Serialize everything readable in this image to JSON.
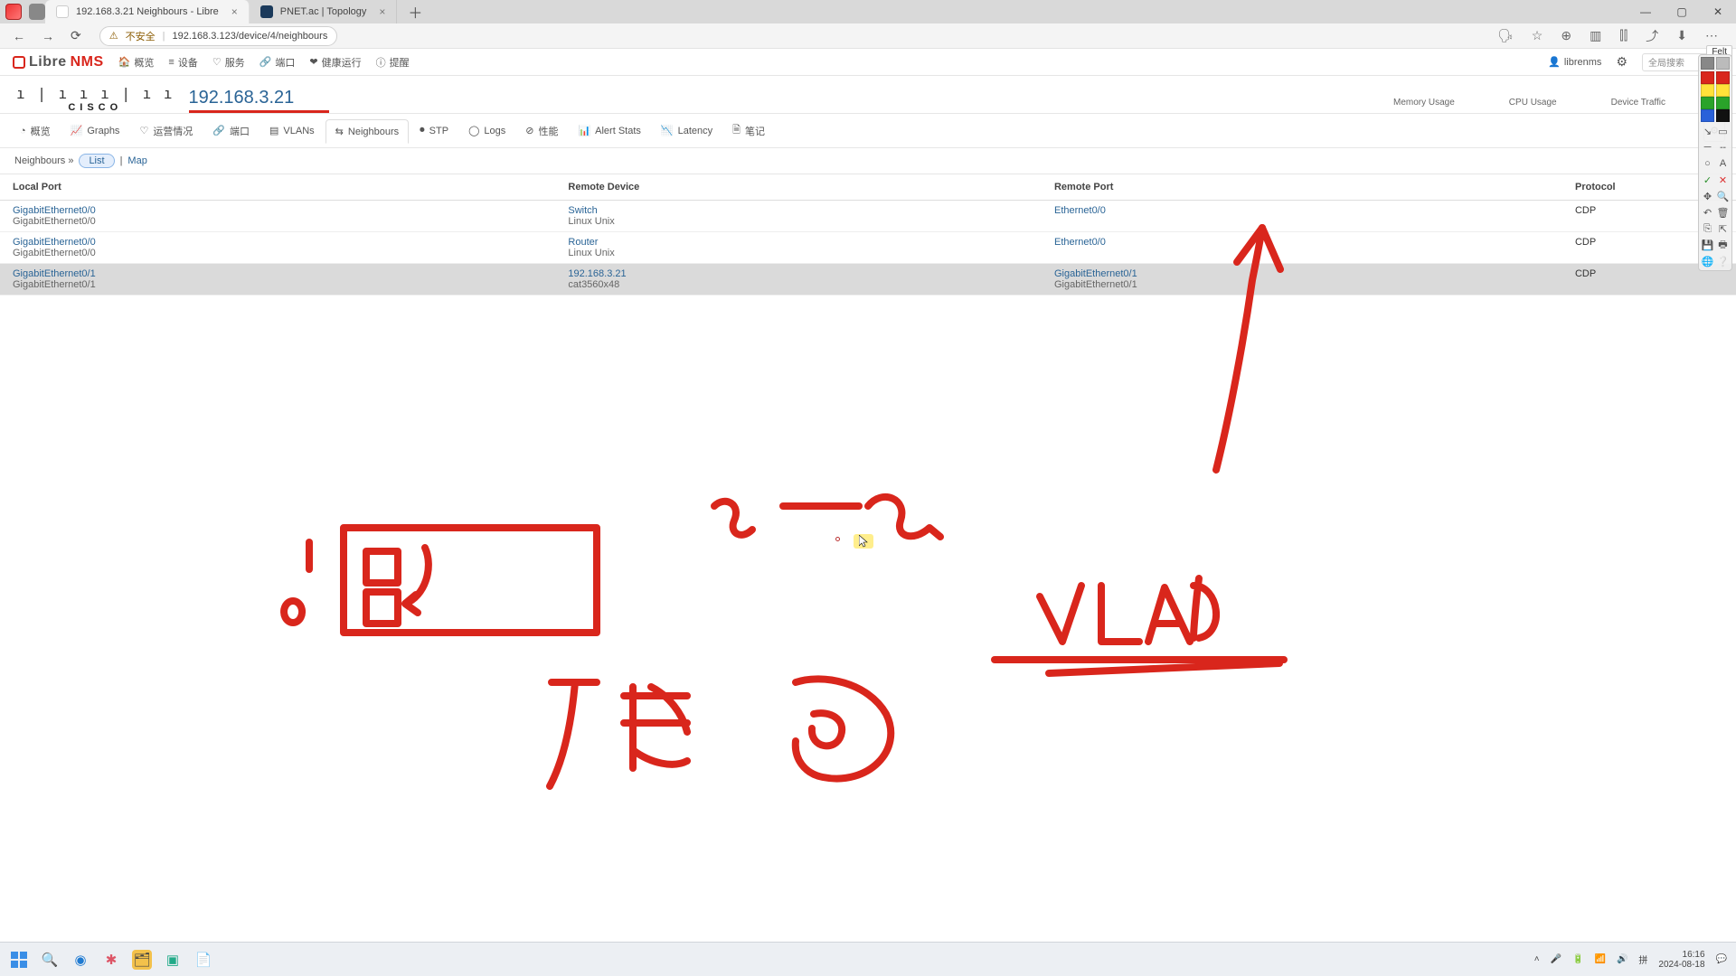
{
  "browser": {
    "tabs": [
      {
        "title": "192.168.3.21 Neighbours - Libre",
        "active": true
      },
      {
        "title": "PNET.ac | Topology",
        "active": false
      }
    ],
    "security_label": "不安全",
    "url": "192.168.3.123/device/4/neighbours",
    "felt_label": "Felt"
  },
  "nms": {
    "brand_prefix": "Libre",
    "brand_suffix": "NMS",
    "menu": [
      "概览",
      "设备",
      "服务",
      "端口",
      "健康运行",
      "提醒"
    ],
    "user": "librenms",
    "search_placeholder": "全局搜索"
  },
  "device": {
    "vendor_top": "ı | ı ı ı | ı ı",
    "vendor_bottom": "CISCO",
    "title": "192.168.3.21",
    "right_stats": [
      "Memory Usage",
      "CPU Usage",
      "Device Traffic"
    ]
  },
  "dtabs": [
    "概览",
    "Graphs",
    "运营情况",
    "端口",
    "VLANs",
    "Neighbours",
    "STP",
    "Logs",
    "性能",
    "Alert Stats",
    "Latency",
    "笔记"
  ],
  "dtabs_active_index": 5,
  "subbar": {
    "prefix": "Neighbours »",
    "list_label": "List",
    "map_label": "Map"
  },
  "table": {
    "headers": [
      "Local Port",
      "Remote Device",
      "Remote Port",
      "Protocol"
    ],
    "rows": [
      {
        "local_port": "GigabitEthernet0/0",
        "local_sub": "GigabitEthernet0/0",
        "remote_dev": "Switch",
        "remote_sub": "Linux Unix",
        "remote_port": "Ethernet0/0",
        "protocol": "CDP",
        "hl": false
      },
      {
        "local_port": "GigabitEthernet0/0",
        "local_sub": "GigabitEthernet0/0",
        "remote_dev": "Router",
        "remote_sub": "Linux Unix",
        "remote_port": "Ethernet0/0",
        "protocol": "CDP",
        "hl": false
      },
      {
        "local_port": "GigabitEthernet0/1",
        "local_sub": "GigabitEthernet0/1",
        "remote_dev": "192.168.3.21",
        "remote_sub": "cat3560x48",
        "remote_port": "GigabitEthernet0/1",
        "remote_port_sub": "GigabitEthernet0/1",
        "protocol": "CDP",
        "hl": true
      }
    ]
  },
  "taskbar": {
    "ime": "拼",
    "time": "16:16",
    "date": "2024-08-18"
  },
  "annotation_colors": [
    "#d9261c",
    "#d9261c",
    "#ffe23a",
    "#ffe23a",
    "#2aa32a",
    "#2aa32a",
    "#2a61d9",
    "#111111"
  ]
}
